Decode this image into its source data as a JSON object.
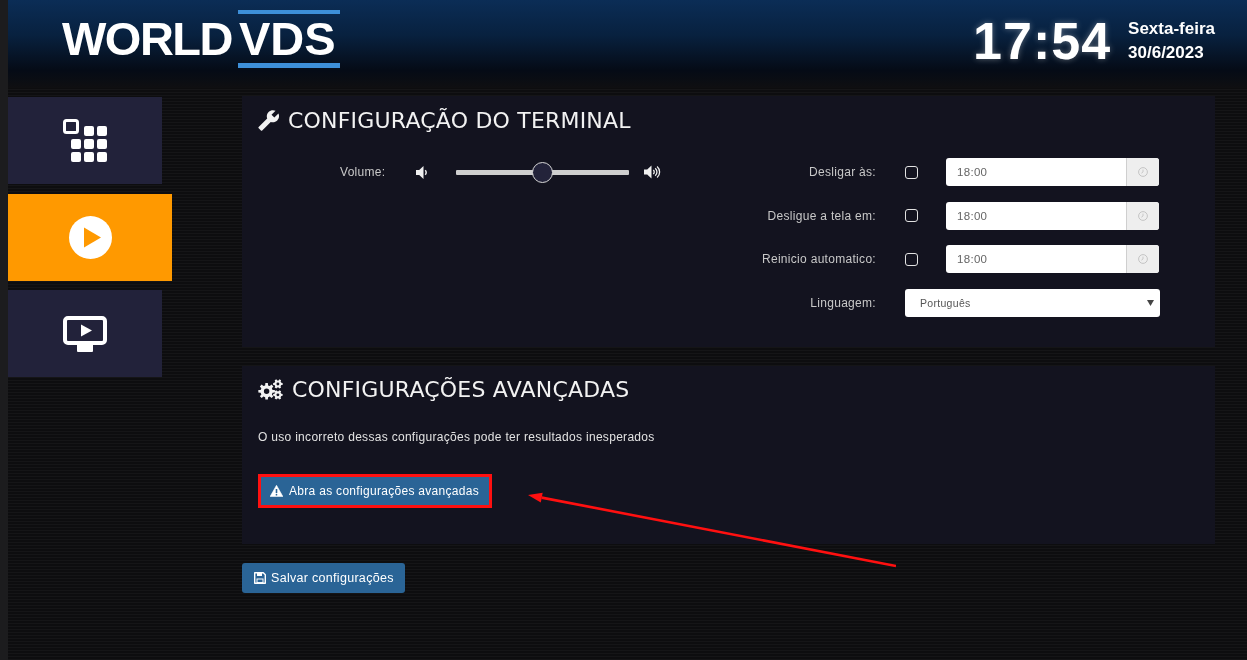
{
  "header": {
    "logo": {
      "primary": "WORLD",
      "secondary": "VDS"
    },
    "clock": {
      "time": "17:54",
      "weekday": "Sexta-feira",
      "date": "30/6/2023"
    }
  },
  "sidebar": {
    "items": [
      {
        "kind": "apps",
        "selected": false
      },
      {
        "kind": "player",
        "selected": true
      },
      {
        "kind": "screen",
        "selected": false
      }
    ]
  },
  "terminal_panel": {
    "title": "CONFIGURAÇÃO DO TERMINAL",
    "volume": {
      "label": "Volume:",
      "level": 0.5
    },
    "schedules": [
      {
        "label": "Desligar às:",
        "checked": false,
        "value": "18:00"
      },
      {
        "label": "Desligue a tela em:",
        "checked": false,
        "value": "18:00"
      },
      {
        "label": "Reinicio automatico:",
        "checked": false,
        "value": "18:00"
      }
    ],
    "language": {
      "label": "Linguagem:",
      "value": "Português"
    }
  },
  "advanced_panel": {
    "title": "CONFIGURAÇÕES AVANÇADAS",
    "warning": "O uso incorreto dessas configurações pode ter resultados inesperados",
    "button": {
      "label": "Abra as configurações avançadas",
      "highlighted": true
    }
  },
  "save_button": {
    "label": "Salvar configurações"
  }
}
